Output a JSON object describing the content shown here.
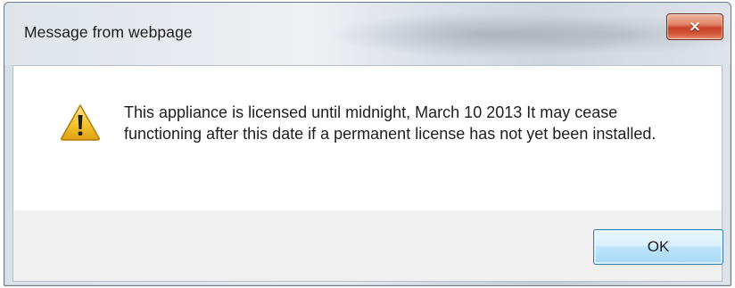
{
  "dialog": {
    "title": "Message from webpage",
    "close_icon": "×",
    "message": "This appliance is licensed until midnight, March 10 2013 It may cease functioning after this date if a permanent license has not yet been installed.",
    "ok_label": "OK"
  },
  "icons": {
    "warning": "warning-icon",
    "close": "close-icon"
  },
  "colors": {
    "close_button": "#c9412a",
    "ok_button_border": "#3c7fb1",
    "warning_fill": "#f4c430"
  }
}
